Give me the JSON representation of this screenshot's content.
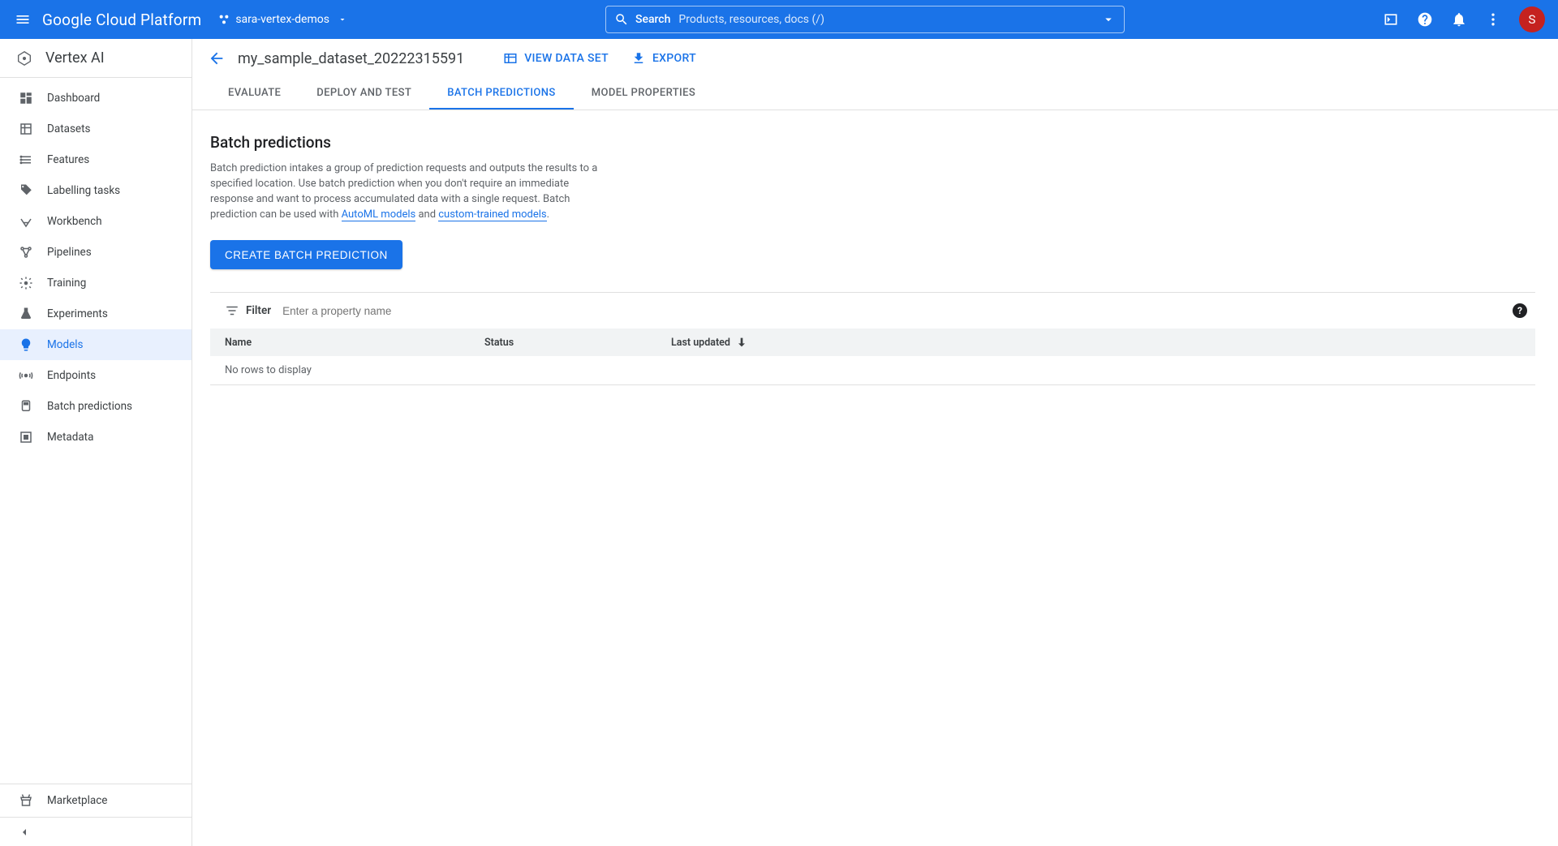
{
  "header": {
    "platform": "Google Cloud Platform",
    "project": "sara-vertex-demos",
    "search_label": "Search",
    "search_placeholder": "Products, resources, docs (/)",
    "avatar_initial": "S"
  },
  "sidebar": {
    "product": "Vertex AI",
    "items": [
      {
        "label": "Dashboard"
      },
      {
        "label": "Datasets"
      },
      {
        "label": "Features"
      },
      {
        "label": "Labelling tasks"
      },
      {
        "label": "Workbench"
      },
      {
        "label": "Pipelines"
      },
      {
        "label": "Training"
      },
      {
        "label": "Experiments"
      },
      {
        "label": "Models"
      },
      {
        "label": "Endpoints"
      },
      {
        "label": "Batch predictions"
      },
      {
        "label": "Metadata"
      }
    ],
    "marketplace": "Marketplace"
  },
  "page": {
    "title": "my_sample_dataset_20222315591",
    "view_dataset": "VIEW DATA SET",
    "export": "EXPORT",
    "tabs": [
      {
        "label": "EVALUATE"
      },
      {
        "label": "DEPLOY AND TEST"
      },
      {
        "label": "BATCH PREDICTIONS"
      },
      {
        "label": "MODEL PROPERTIES"
      }
    ]
  },
  "content": {
    "heading": "Batch predictions",
    "desc_part1": "Batch prediction intakes a group of prediction requests and outputs the results to a specified location. Use batch prediction when you don't require an immediate response and want to process accumulated data with a single request. Batch prediction can be used with ",
    "link1": "AutoML models",
    "desc_and": " and ",
    "link2": "custom-trained models",
    "desc_end": ".",
    "create_button": "CREATE BATCH PREDICTION",
    "filter_label": "Filter",
    "filter_placeholder": "Enter a property name",
    "columns": {
      "name": "Name",
      "status": "Status",
      "last_updated": "Last updated"
    },
    "empty": "No rows to display"
  }
}
